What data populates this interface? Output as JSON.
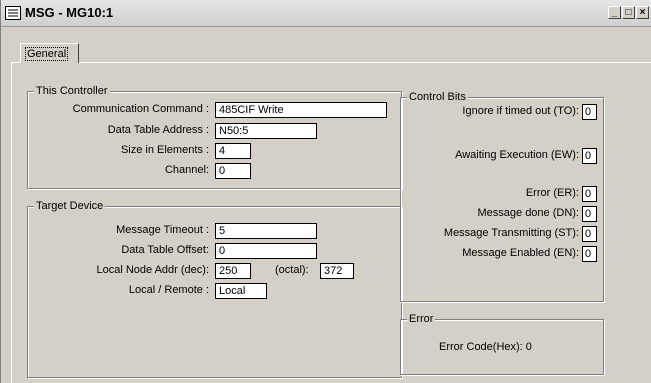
{
  "window": {
    "title": "MSG - MG10:1"
  },
  "tabs": [
    {
      "label": "General"
    }
  ],
  "this_controller": {
    "legend": "This Controller",
    "communication_command": {
      "label": "Communication Command :",
      "value": "485CIF Write"
    },
    "data_table_address": {
      "label": "Data Table Address :",
      "value": "N50:5"
    },
    "size_in_elements": {
      "label": "Size in Elements :",
      "value": "4"
    },
    "channel": {
      "label": "Channel:",
      "value": "0"
    }
  },
  "target_device": {
    "legend": "Target Device",
    "message_timeout": {
      "label": "Message Timeout :",
      "value": "5"
    },
    "data_table_offset": {
      "label": "Data Table Offset:",
      "value": "0"
    },
    "local_node_addr": {
      "label": "Local Node Addr (dec):",
      "value": "250",
      "octal_label": "(octal):",
      "octal_value": "372"
    },
    "local_remote": {
      "label": "Local / Remote :",
      "value": "Local"
    }
  },
  "control_bits": {
    "legend": "Control Bits",
    "items": [
      {
        "label": "Ignore if timed out (TO):",
        "value": "0"
      },
      {
        "label": "Awaiting Execution (EW):",
        "value": "0"
      },
      {
        "label": "Error (ER):",
        "value": "0"
      },
      {
        "label": "Message done (DN):",
        "value": "0"
      },
      {
        "label": "Message Transmitting (ST):",
        "value": "0"
      },
      {
        "label": "Message Enabled (EN):",
        "value": "0"
      }
    ]
  },
  "error": {
    "legend": "Error",
    "text": "Error Code(Hex):  0"
  }
}
